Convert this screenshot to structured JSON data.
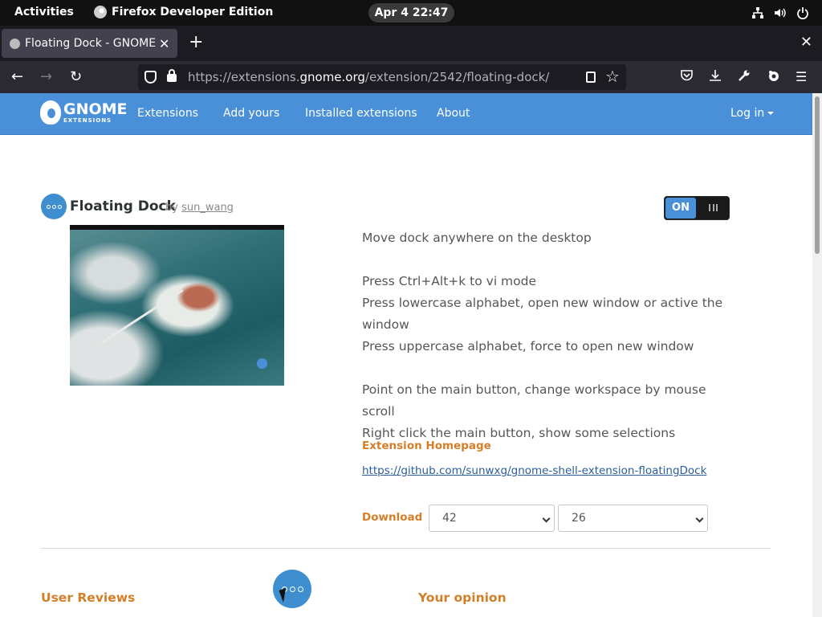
{
  "topbar": {
    "activities": "Activities",
    "app_name": "Firefox Developer Edition",
    "clock": "Apr 4  22:47"
  },
  "browser": {
    "tab_title": "Floating Dock - GNOME S",
    "url_prefix": "https://extensions.",
    "url_domain": "gnome.org",
    "url_path": "/extension/2542/floating-dock/"
  },
  "site_nav": {
    "logo_word": "GNOME",
    "logo_sub": "EXTENSIONS",
    "links": [
      "Extensions",
      "Add yours",
      "Installed extensions",
      "About"
    ],
    "login": "Log in"
  },
  "extension": {
    "name": "Floating Dock",
    "by": "by",
    "author": "sun_wang",
    "toggle_label": "ON",
    "description": [
      "Move dock anywhere on the desktop",
      "",
      "Press Ctrl+Alt+k to vi mode",
      "Press lowercase alphabet, open new window or active the window",
      "Press uppercase alphabet, force to open new window",
      "",
      "Point on the main button, change workspace by mouse scroll",
      "Right click the main button, show some selections"
    ],
    "homepage_label": "Extension Homepage",
    "homepage_url": "https://github.com/sunwxg/gnome-shell-extension-floatingDock",
    "download_label": "Download",
    "shell_version": "42",
    "extension_version": "26"
  },
  "sections": {
    "reviews": "User Reviews",
    "opinion": "Your opinion"
  },
  "colors": {
    "accent_blue": "#4a90d9",
    "heading_orange": "#d47f28",
    "link_blue": "#2a5d9c"
  }
}
